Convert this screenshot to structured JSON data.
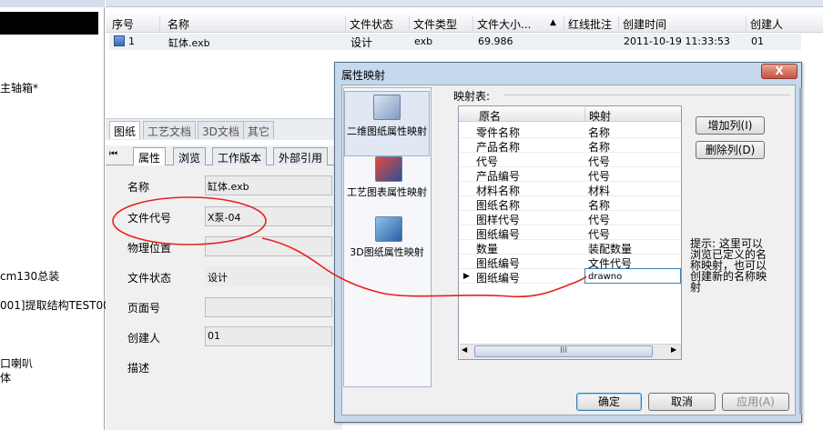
{
  "left_panel": {
    "items": [
      "主轴箱*",
      "cm130总装",
      "001]提取结构TEST00",
      "口喇叭",
      "体"
    ]
  },
  "top_strip": {
    "title": "图纸"
  },
  "file_table": {
    "columns": [
      "序号",
      "名称",
      "文件状态",
      "文件类型",
      "文件大小...",
      "红线批注",
      "创建时间",
      "创建人"
    ],
    "rows": [
      {
        "index": "1",
        "name": "缸体.exb",
        "status": "设计",
        "type": "exb",
        "size": "69.986",
        "redline": "",
        "created": "2011-10-19 11:33:53",
        "creator": "01"
      }
    ]
  },
  "doc_tabs": [
    "图纸",
    "工艺文档",
    "3D文档",
    "其它"
  ],
  "prop_tabs": [
    "属性",
    "浏览",
    "工作版本",
    "外部引用"
  ],
  "properties": [
    {
      "label": "名称",
      "value": "缸体.exb"
    },
    {
      "label": "文件代号",
      "value": "X泵-04"
    },
    {
      "label": "物理位置",
      "value": ""
    },
    {
      "label": "文件状态",
      "value": "设计"
    },
    {
      "label": "页面号",
      "value": ""
    },
    {
      "label": "创建人",
      "value": "01"
    },
    {
      "label": "描述",
      "value": ""
    }
  ],
  "dialog": {
    "title": "属性映射",
    "close_label": "X",
    "nav": [
      {
        "label": "二维图纸属性映射",
        "icon": "drawing-table-icon"
      },
      {
        "label": "工艺图表属性映射",
        "icon": "process-pencil-icon"
      },
      {
        "label": "3D图纸属性映射",
        "icon": "3d-model-icon"
      }
    ],
    "map_title": "映射表:",
    "grid_columns": [
      "原名",
      "映射"
    ],
    "grid_rows": [
      {
        "orig": "零件名称",
        "map": "名称"
      },
      {
        "orig": "产品名称",
        "map": "名称"
      },
      {
        "orig": "代号",
        "map": "代号"
      },
      {
        "orig": "产品编号",
        "map": "代号"
      },
      {
        "orig": "材料名称",
        "map": "材料"
      },
      {
        "orig": "图纸名称",
        "map": "名称"
      },
      {
        "orig": "图样代号",
        "map": "代号"
      },
      {
        "orig": "图纸编号",
        "map": "代号"
      },
      {
        "orig": "数量",
        "map": "装配数量"
      },
      {
        "orig": "图纸编号",
        "map": "文件代号"
      },
      {
        "orig": "图纸编号",
        "map": "drawno"
      }
    ],
    "scroll_thumb": "III",
    "add_col": "增加列(I)",
    "del_col": "删除列(D)",
    "hint": "提示: 这里可以浏览已定义的名称映射，也可以创建新的名称映射",
    "ok": "确定",
    "cancel": "取消",
    "apply": "应用(A)"
  }
}
